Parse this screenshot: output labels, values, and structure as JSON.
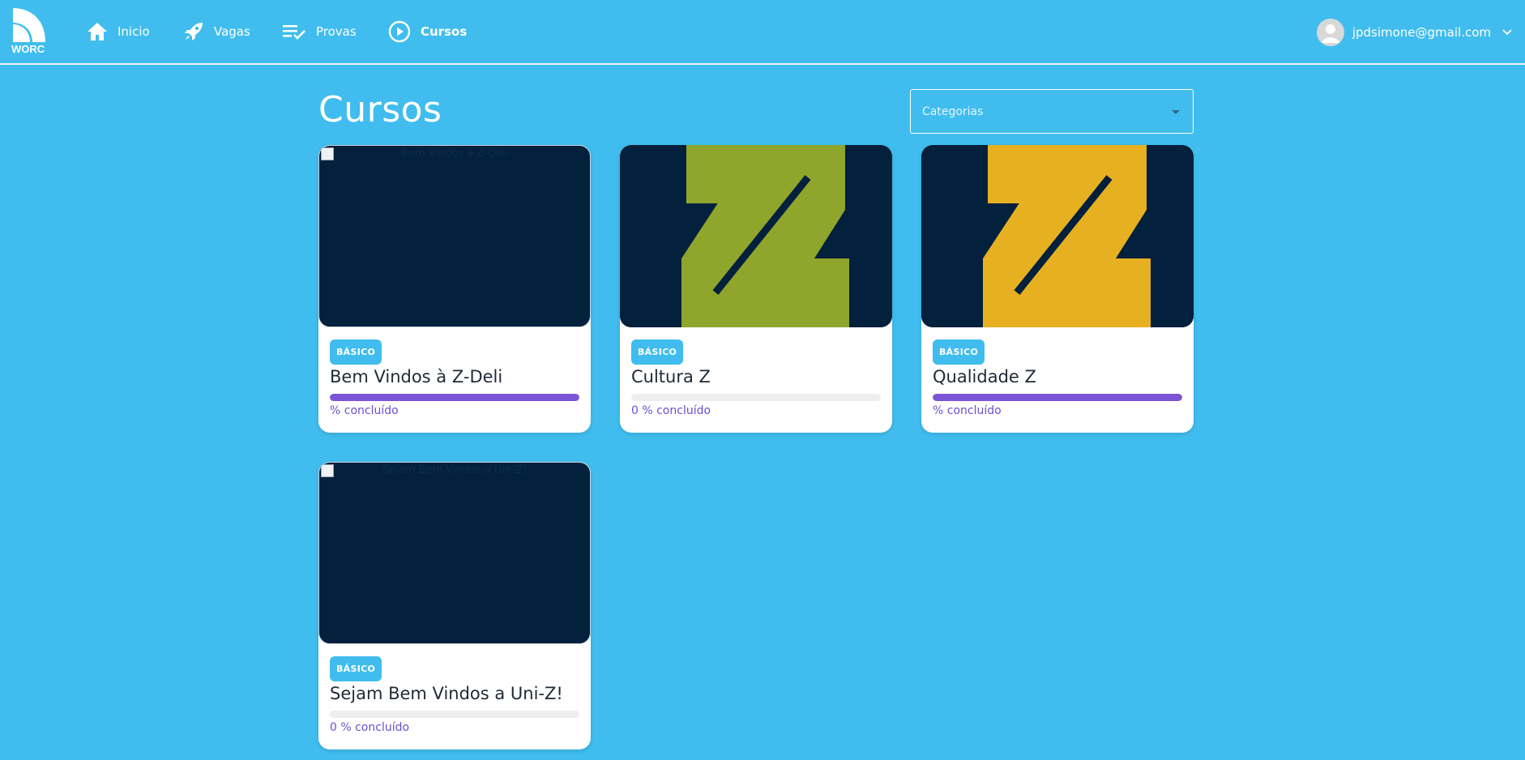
{
  "brand": {
    "logo_text": "WORC"
  },
  "nav": {
    "items": [
      {
        "label": "Inicio",
        "icon": "home-icon"
      },
      {
        "label": "Vagas",
        "icon": "rocket-icon"
      },
      {
        "label": "Provas",
        "icon": "checklist-icon"
      },
      {
        "label": "Cursos",
        "icon": "play-circle-icon",
        "active": true
      }
    ]
  },
  "user": {
    "email": "jpdsimone@gmail.com",
    "avatar_icon": "user-avatar-icon",
    "menu_icon": "chevron-down-icon"
  },
  "main": {
    "title": "Cursos",
    "category_select": {
      "placeholder": "Categorias",
      "selected": ""
    }
  },
  "courses": [
    {
      "title": "Bem Vindos à Z-Deli",
      "level": "BÁSICO",
      "image_alt": "Bem Vindos à Z-Deli",
      "image_loaded": false,
      "progress_text": "% concluído",
      "progress": 1.0
    },
    {
      "title": "Cultura Z",
      "level": "BÁSICO",
      "image_alt": "Cultura Z",
      "image_loaded": true,
      "image_accent": "#8fa52b",
      "progress_text": "0 % concluído",
      "progress": 0.0
    },
    {
      "title": "Qualidade Z",
      "level": "BÁSICO",
      "image_alt": "Qualidade Z",
      "image_loaded": true,
      "image_accent": "#e6b020",
      "progress_text": "% concluído",
      "progress": 1.0
    },
    {
      "title": "Sejam Bem Vindos a Uni-Z!",
      "level": "BÁSICO",
      "image_alt": "Sejam Bem Vindos a Uni-Z!",
      "image_loaded": false,
      "progress_text": "0 % concluído",
      "progress": 0.0
    }
  ],
  "colors": {
    "background": "#40bdee",
    "card_image_bg": "#03203c",
    "progress": "#7c55d6",
    "badge": "#40bdee"
  }
}
